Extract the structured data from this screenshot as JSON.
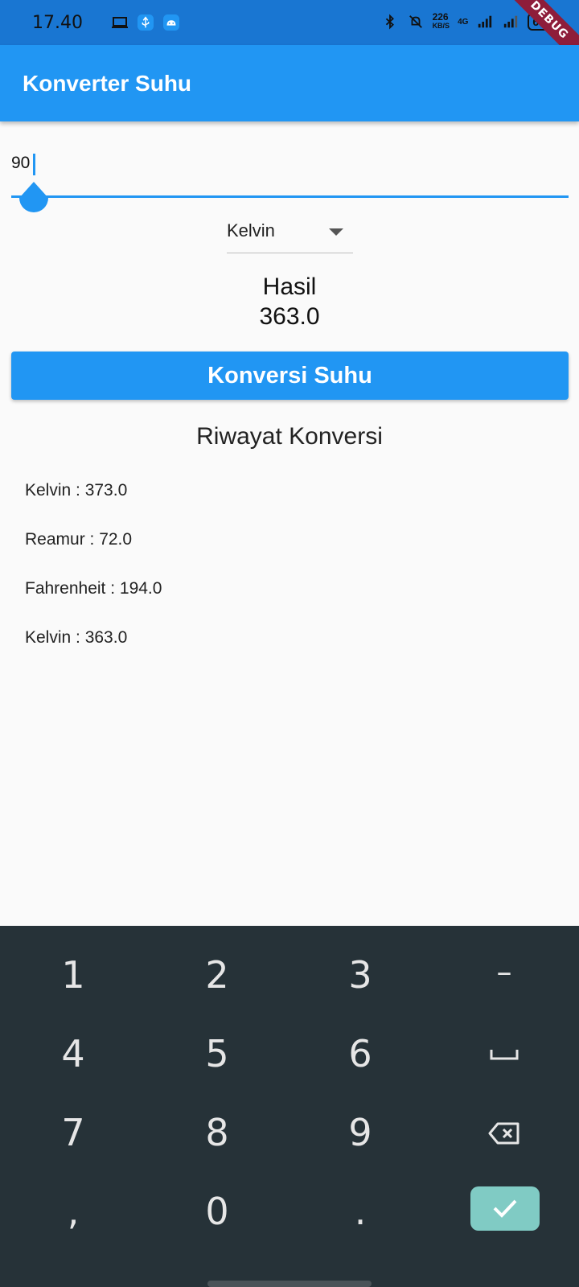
{
  "status_bar": {
    "time": "17.40",
    "speed_value": "226",
    "speed_unit": "KB/S",
    "network": "4G",
    "battery": "65"
  },
  "debug_banner": "DEBUG",
  "app_bar": {
    "title": "Konverter Suhu"
  },
  "input": {
    "value": "90"
  },
  "dropdown": {
    "selected": "Kelvin"
  },
  "result": {
    "label": "Hasil",
    "value": "363.0"
  },
  "convert_button": {
    "label": "Konversi Suhu"
  },
  "history": {
    "title": "Riwayat Konversi",
    "items": [
      "Kelvin : 373.0",
      "Reamur : 72.0",
      "Fahrenheit : 194.0",
      "Kelvin : 363.0"
    ]
  },
  "keyboard": {
    "rows": [
      [
        "1",
        "2",
        "3",
        "–"
      ],
      [
        "4",
        "5",
        "6",
        "space"
      ],
      [
        "7",
        "8",
        "9",
        "backspace"
      ],
      [
        ",",
        "0",
        ".",
        "done"
      ]
    ]
  },
  "colors": {
    "primary": "#2196f3",
    "status_bar": "#1976d2",
    "keyboard_bg": "#263238",
    "done_key": "#80cbc4",
    "debug": "#8e1d3a"
  }
}
